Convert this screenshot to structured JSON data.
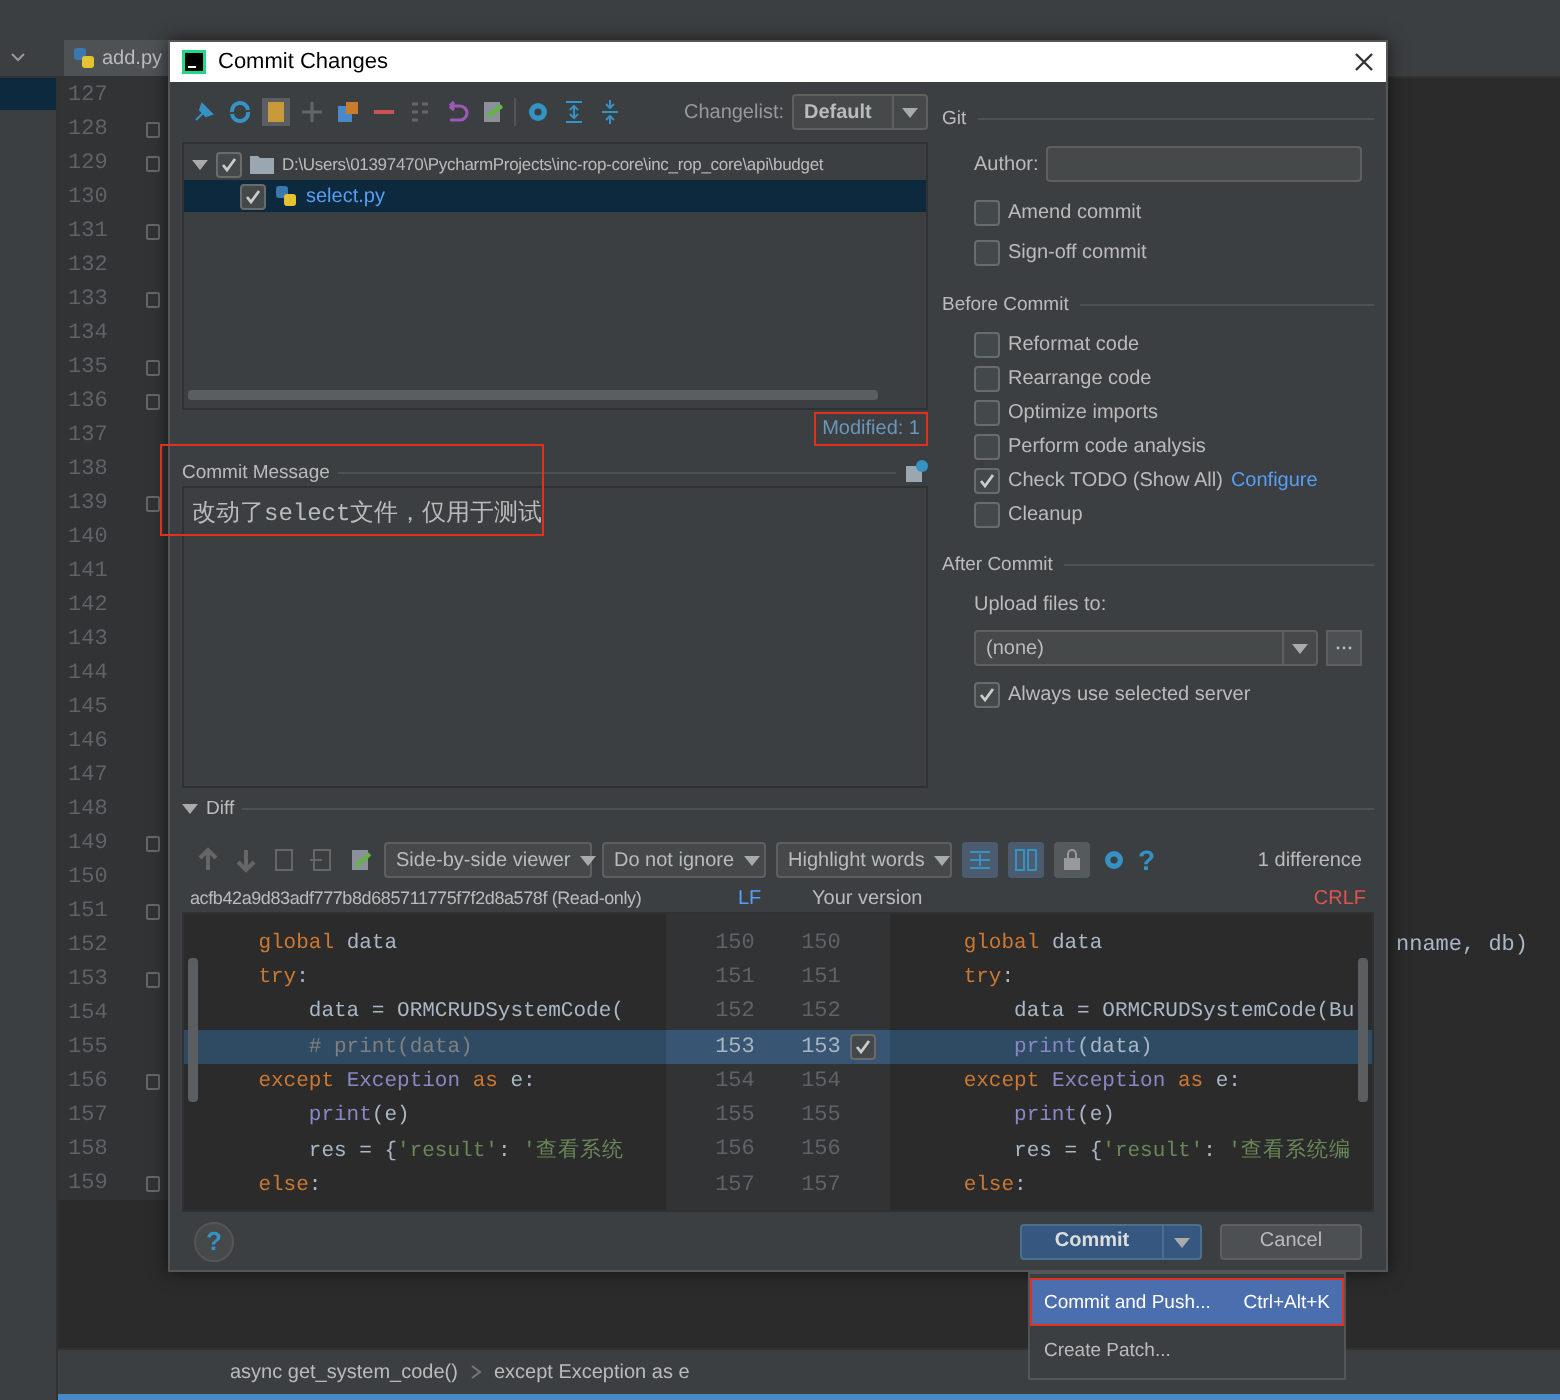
{
  "tab": {
    "label": "add.py"
  },
  "editor": {
    "lines": [
      {
        "number": "127",
        "fold": false
      },
      {
        "number": "128",
        "fold": true
      },
      {
        "number": "129",
        "fold": true
      },
      {
        "number": "130",
        "fold": false
      },
      {
        "number": "131",
        "fold": true
      },
      {
        "number": "132",
        "fold": false
      },
      {
        "number": "133",
        "fold": true
      },
      {
        "number": "134",
        "fold": false
      },
      {
        "number": "135",
        "fold": true
      },
      {
        "number": "136",
        "fold": true
      },
      {
        "number": "137",
        "fold": false
      },
      {
        "number": "138",
        "fold": false
      },
      {
        "number": "139",
        "fold": true
      },
      {
        "number": "140",
        "fold": false
      },
      {
        "number": "141",
        "fold": false
      },
      {
        "number": "142",
        "fold": false
      },
      {
        "number": "143",
        "fold": false
      },
      {
        "number": "144",
        "fold": false
      },
      {
        "number": "145",
        "fold": false
      },
      {
        "number": "146",
        "fold": false
      },
      {
        "number": "147",
        "fold": false
      },
      {
        "number": "148",
        "fold": false
      },
      {
        "number": "149",
        "fold": true
      },
      {
        "number": "150",
        "fold": false
      },
      {
        "number": "151",
        "fold": true
      },
      {
        "number": "152",
        "fold": false,
        "text": "nname, db)"
      },
      {
        "number": "153",
        "fold": true
      },
      {
        "number": "154",
        "fold": false
      },
      {
        "number": "155",
        "fold": false
      },
      {
        "number": "156",
        "fold": true
      },
      {
        "number": "157",
        "fold": false
      },
      {
        "number": "158",
        "fold": false
      },
      {
        "number": "159",
        "fold": true
      }
    ]
  },
  "breadcrumbs": [
    "async get_system_code()",
    "except Exception as e"
  ],
  "dialog": {
    "title": "Commit Changes",
    "changelist": {
      "label": "Changelist:",
      "value": "Default"
    },
    "tree": [
      {
        "label": "D:\\Users\\01397470\\PycharmProjects\\inc-rop-core\\inc_rop_core\\api\\budget",
        "checked": true,
        "expanded": true,
        "selected": false,
        "children": [
          {
            "label": "select.py",
            "checked": true,
            "selected": true
          }
        ]
      }
    ],
    "modified": "Modified: 1",
    "commit_message": {
      "label": "Commit Message",
      "value": "改动了select文件，仅用于测试"
    },
    "git": {
      "title": "Git",
      "author_label": "Author:",
      "options": [
        {
          "label": "Amend commit",
          "checked": false
        },
        {
          "label": "Sign-off commit",
          "checked": false
        }
      ]
    },
    "before_commit": {
      "title": "Before Commit",
      "options": [
        {
          "label": "Reformat code",
          "checked": false
        },
        {
          "label": "Rearrange code",
          "checked": false
        },
        {
          "label": "Optimize imports",
          "checked": false
        },
        {
          "label": "Perform code analysis",
          "checked": false
        },
        {
          "label": "Check TODO (Show All)",
          "checked": true,
          "link": "Configure"
        },
        {
          "label": "Cleanup",
          "checked": false
        }
      ]
    },
    "after_commit": {
      "title": "After Commit",
      "upload_label": "Upload files to:",
      "server": "(none)",
      "options": [
        {
          "label": "Always use selected server",
          "checked": true
        }
      ]
    },
    "diff": {
      "title": "Diff",
      "expanded": true,
      "viewer": "Side-by-side viewer",
      "ignore": "Do not ignore",
      "highlight": "Highlight words",
      "help": "?",
      "count": "1 difference",
      "left_title": "acfb42a9d83adf777b8d685711775f7f2d8a578f (Read-only)",
      "left_eol": "LF",
      "right_title": "Your version",
      "right_eol": "CRLF",
      "rows": [
        {
          "left_number": "150",
          "right_number": "150",
          "changed": false,
          "left": [
            {
              "kind": "keyword",
              "text": "    global"
            },
            {
              "kind": "plain",
              "text": " data"
            }
          ],
          "right": [
            {
              "kind": "keyword",
              "text": "    global"
            },
            {
              "kind": "plain",
              "text": " data"
            }
          ]
        },
        {
          "left_number": "151",
          "right_number": "151",
          "changed": false,
          "left": [
            {
              "kind": "keyword",
              "text": "    try"
            },
            {
              "kind": "plain",
              "text": ":"
            }
          ],
          "right": [
            {
              "kind": "keyword",
              "text": "    try"
            },
            {
              "kind": "plain",
              "text": ":"
            }
          ]
        },
        {
          "left_number": "152",
          "right_number": "152",
          "changed": false,
          "left": [
            {
              "kind": "plain",
              "text": "        data = ORMCRUDSystemCode("
            }
          ],
          "right": [
            {
              "kind": "plain",
              "text": "        data = ORMCRUDSystemCode(Bu"
            }
          ]
        },
        {
          "left_number": "153",
          "right_number": "153",
          "changed": true,
          "left": [
            {
              "kind": "comment",
              "text": "        # print(data)"
            }
          ],
          "right": [
            {
              "kind": "builtin",
              "text": "        print"
            },
            {
              "kind": "plain",
              "text": "(data)"
            }
          ]
        },
        {
          "left_number": "154",
          "right_number": "154",
          "changed": false,
          "left": [
            {
              "kind": "keyword",
              "text": "    except"
            },
            {
              "kind": "builtin",
              "text": " Exception"
            },
            {
              "kind": "keyword",
              "text": " as"
            },
            {
              "kind": "plain",
              "text": " e:"
            }
          ],
          "right": [
            {
              "kind": "keyword",
              "text": "    except"
            },
            {
              "kind": "builtin",
              "text": " Exception"
            },
            {
              "kind": "keyword",
              "text": " as"
            },
            {
              "kind": "plain",
              "text": " e:"
            }
          ]
        },
        {
          "left_number": "155",
          "right_number": "155",
          "changed": false,
          "left": [
            {
              "kind": "builtin",
              "text": "        print"
            },
            {
              "kind": "plain",
              "text": "(e)"
            }
          ],
          "right": [
            {
              "kind": "builtin",
              "text": "        print"
            },
            {
              "kind": "plain",
              "text": "(e)"
            }
          ]
        },
        {
          "left_number": "156",
          "right_number": "156",
          "changed": false,
          "left": [
            {
              "kind": "plain",
              "text": "        res = {"
            },
            {
              "kind": "string",
              "text": "'result'"
            },
            {
              "kind": "plain",
              "text": ": "
            },
            {
              "kind": "string",
              "text": "'查看系统"
            }
          ],
          "right": [
            {
              "kind": "plain",
              "text": "        res = {"
            },
            {
              "kind": "string",
              "text": "'result'"
            },
            {
              "kind": "plain",
              "text": ": "
            },
            {
              "kind": "string",
              "text": "'查看系统编"
            }
          ]
        },
        {
          "left_number": "157",
          "right_number": "157",
          "changed": false,
          "left": [
            {
              "kind": "keyword",
              "text": "    else"
            },
            {
              "kind": "plain",
              "text": ":"
            }
          ],
          "right": [
            {
              "kind": "keyword",
              "text": "    else"
            },
            {
              "kind": "plain",
              "text": ":"
            }
          ]
        }
      ]
    },
    "help": "?",
    "buttons": {
      "commit": "Commit",
      "cancel": "Cancel"
    },
    "menu": [
      {
        "label": "Commit and Push...",
        "shortcut": "Ctrl+Alt+K",
        "selected": true
      },
      {
        "label": "Create Patch...",
        "selected": false
      }
    ]
  }
}
